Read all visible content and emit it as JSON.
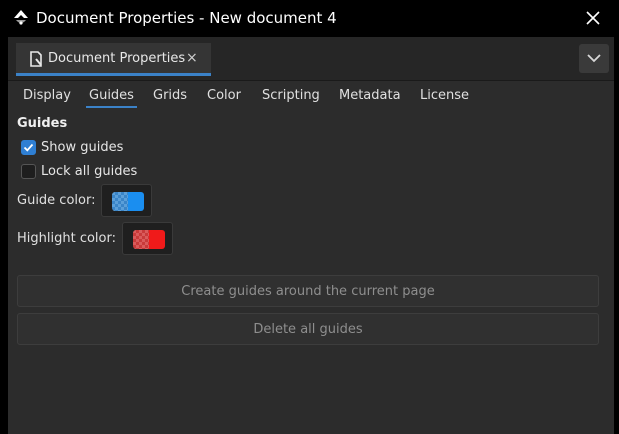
{
  "window": {
    "title": "Document Properties - New document 4",
    "icon": "inkscape-logo-icon",
    "close_icon": "close-icon"
  },
  "dock": {
    "tab_label": "Document Properties",
    "tab_icon": "document-properties-icon",
    "tab_close": "×",
    "menu_icon": "chevron-down-icon"
  },
  "tabs": [
    {
      "label": "Display",
      "active": false
    },
    {
      "label": "Guides",
      "active": true
    },
    {
      "label": "Grids",
      "active": false
    },
    {
      "label": "Color",
      "active": false
    },
    {
      "label": "Scripting",
      "active": false
    },
    {
      "label": "Metadata",
      "active": false
    },
    {
      "label": "License",
      "active": false
    }
  ],
  "guides": {
    "section_title": "Guides",
    "show_guides": {
      "label": "Show guides",
      "checked": true
    },
    "lock_guides": {
      "label": "Lock all guides",
      "checked": false
    },
    "guide_color": {
      "label": "Guide color:",
      "color": "#1a8ef0"
    },
    "highlight_color": {
      "label": "Highlight color:",
      "color": "#f01a1a"
    },
    "create_button": "Create guides around the current page",
    "delete_button": "Delete all guides"
  },
  "colors": {
    "accent": "#3b82c8",
    "checkbox_checked": "#2f7fd3"
  }
}
